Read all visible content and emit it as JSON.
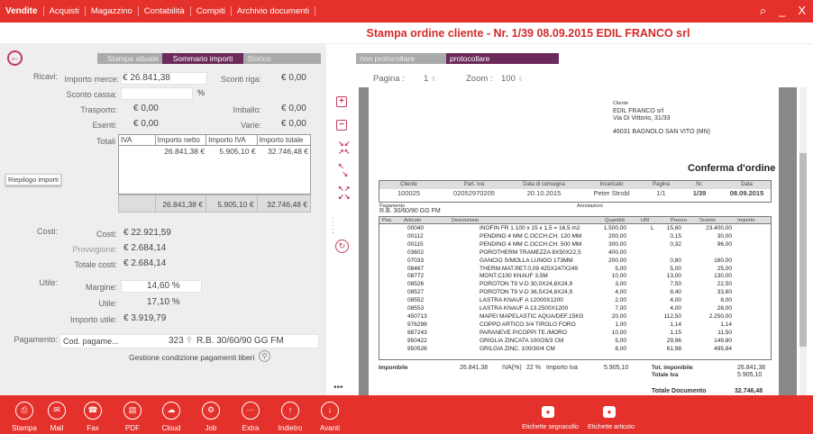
{
  "menu": [
    "Vendite",
    "Acquisti",
    "Magazzino",
    "Contabilità",
    "Compiti",
    "Archivio documenti"
  ],
  "topicons": {
    "search": "⌕",
    "minimize": "_",
    "close": "X"
  },
  "title": "Stampa ordine cliente - Nr. 1/39 08.09.2015 EDIL FRANCO srl",
  "left_tabs": [
    "Stampa attuale",
    "Sommario importi",
    "Storico"
  ],
  "ricavi": {
    "section": "Ricavi:",
    "importo_merce_label": "Importo merce:",
    "importo_merce": "€ 26.841,38",
    "sconti_riga_label": "Sconti riga:",
    "sconti_riga": "€ 0,00",
    "sconto_cassa_label": "Sconto cassa:",
    "sconto_cassa_unit": "%",
    "trasporto_label": "Trasporto:",
    "trasporto": "€ 0,00",
    "imballo_label": "Imballo:",
    "imballo": "€ 0,00",
    "esenti_label": "Esenti:",
    "esenti": "€ 0,00",
    "varie_label": "Varie:",
    "varie": "€ 0,00",
    "totali_label": "Totali"
  },
  "iva_table": {
    "headers": [
      "IVA",
      "Importo netto",
      "Importo IVA",
      "Importo totale"
    ],
    "row": [
      "",
      "26.841,38 €",
      "5.905,10 €",
      "32.746,48 €"
    ],
    "total": [
      "",
      "26.841,38 €",
      "5.905,10 €",
      "32.746,48 €"
    ]
  },
  "riepilogo": "Riepilogo importi",
  "costi": {
    "section": "Costi:",
    "costi_label": "Costi:",
    "costi": "€ 22.921,59",
    "provvigione_label": "Provvigione:",
    "provvigione": "€ 2.684,14",
    "totale_costi_label": "Totale costi:",
    "totale_costi": "€ 2.684,14"
  },
  "utile": {
    "section": "Utile:",
    "margine_label": "Margine:",
    "margine": "14,60 %",
    "utile_label": "Utile:",
    "utile": "17,10 %",
    "importo_utile_label": "Importo utile:",
    "importo_utile": "€ 3.919,79"
  },
  "pagamento": {
    "section": "Pagamento:",
    "cod_label": "Cod. pagame...",
    "code": "323",
    "desc": "R.B. 30/60/90 GG FM",
    "gestione": "Gestione condizione pagamenti liberi"
  },
  "right_tabs": [
    "non protocollare",
    "protocollare"
  ],
  "pager": {
    "pagina_label": "Pagina :",
    "pagina": "1",
    "zoom_label": "Zoom :",
    "zoom": "100"
  },
  "doc": {
    "cliente_label": "Cliente",
    "cliente_name": "EDIL FRANCO srl",
    "cliente_addr": "Via Di Vittorio, 31/33",
    "cliente_city": "46031 BAGNOLO SAN VITO (MN)",
    "doc_title": "Conferma d'ordine",
    "hdr_labels": [
      "Cliente",
      "Part. Iva",
      "Data di consegna",
      "Incaricato",
      "Pagina",
      "Nr.",
      "Data"
    ],
    "hdr_values": [
      "100025",
      "02052970205",
      "20.10.2015",
      "Peter Strobl",
      "1/1",
      "1/39",
      "08.09.2015"
    ],
    "pagamento_label": "Pagamento",
    "pagamento": "R.B. 30/60/90 GG FM",
    "annotazioni_label": "Annotazioni",
    "cols": [
      "Pos.",
      "Articolo",
      "Descrizione",
      "Quantità",
      "UM",
      "Prezzo",
      "Sconto",
      "Importo"
    ],
    "rows": [
      [
        "00040",
        "INOFIN FR 1.100 x 15 x 1,5 = 16,5 m2",
        "1.500,00",
        "L",
        "15,60",
        "23.400,00"
      ],
      [
        "00112",
        "PENDINO 4 MM C.OCCH.CH. 120 MM",
        "200,00",
        "",
        "0,15",
        "30,00"
      ],
      [
        "00115",
        "PENDINO 4 MM C.OCCH.CH. 500 MM",
        "300,00",
        "",
        "0,32",
        "96,00"
      ],
      [
        "03602",
        "POROTHERM TRAMEZZA 8X50X22,5",
        "400,00",
        "",
        "",
        ""
      ],
      [
        "07033",
        "GANCIO S/MOLLA LUNGO 173MM",
        "200,00",
        "",
        "0,80",
        "160,00"
      ],
      [
        "08467",
        "THERM.MAT.RET.0,09 425X247X249",
        "5,00",
        "",
        "5,00",
        "25,00"
      ],
      [
        "08772",
        "MONT.C100 KNAUF 3,5M",
        "10,00",
        "",
        "13,00",
        "130,00"
      ],
      [
        "08526",
        "POROTON T9 V-D 30,0X24,8X24,9",
        "3,00",
        "",
        "7,50",
        "22,50"
      ],
      [
        "08527",
        "POROTON T9 V-D 36,5X24,8X24,9",
        "4,00",
        "",
        "8,40",
        "33,60"
      ],
      [
        "08552",
        "LASTRA KNAUF A 12000X1200",
        "2,00",
        "",
        "4,00",
        "8,00"
      ],
      [
        "08553",
        "LASTRA KNAUF A 13.2500X1200",
        "7,00",
        "",
        "4,00",
        "28,00"
      ],
      [
        "450713",
        "MAPEI MAPELASTIC AQUA/DEF.15KG",
        "20,00",
        "",
        "112,50",
        "2.250,00"
      ],
      [
        "976298",
        "COPPO ARTICO 3/4 TIROLO FORO",
        "1,00",
        "",
        "1,14",
        "1,14"
      ],
      [
        "887243",
        "PARANEVE P/COPPI TE./MORO",
        "10,00",
        "",
        "1,15",
        "11,50"
      ],
      [
        "950422",
        "GRIGLIA ZINCATA 100/28/3 CM",
        "5,00",
        "",
        "29,96",
        "149,80"
      ],
      [
        "950526",
        "GRILGIA ZINC. 100/30/4 CM",
        "8,00",
        "",
        "61,98",
        "495,84"
      ]
    ],
    "imponibile_label": "Imponibile",
    "imponibile": "26.841,38",
    "iva_label": "IVA(%)",
    "iva_pct": "22 %",
    "importo_iva_label": "Importo Iva",
    "importo_iva": "5.905,10",
    "tot_imp_label": "Tot. imponibile",
    "tot_imp": "26.841,38",
    "totale_iva_label": "Totale Iva",
    "totale_iva": "5.905,10",
    "totale_doc_label": "Totale Documento",
    "totale_doc": "32.746,48"
  },
  "bottom_buttons": [
    "Stampa",
    "Mail",
    "Fax",
    "PDF",
    "Cloud",
    "Job",
    "Extra",
    "Indietro",
    "Avanti"
  ],
  "bottom_right": [
    "Etichette segnacollo",
    "Etichette articolo"
  ]
}
